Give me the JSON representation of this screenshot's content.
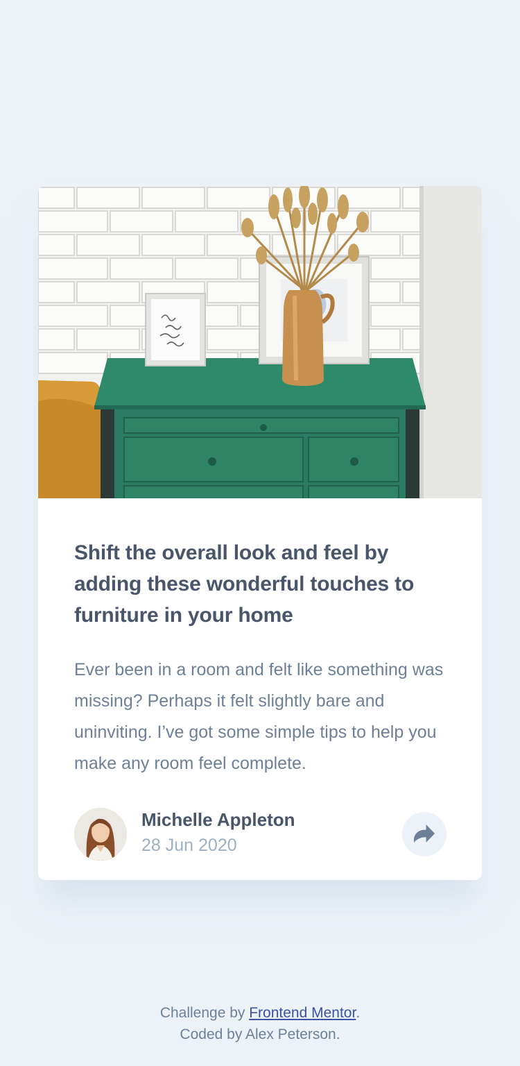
{
  "card": {
    "image_alt": "Green drawer with framed prints and vase of dried grass",
    "title": "Shift the overall look and feel by adding these wonderful touches to furniture in your home",
    "description": "Ever been in a room and felt like something was missing? Perhaps it felt slightly bare and uninviting. I’ve got some simple tips to help you make any room feel complete.",
    "author": {
      "name": "Michelle Appleton",
      "date": "28 Jun 2020",
      "avatar_icon": "avatar-michelle"
    },
    "share_icon": "share-icon"
  },
  "attribution": {
    "prefix": "Challenge by ",
    "link_text": "Frontend Mentor",
    "suffix": ".",
    "line2": "Coded by Alex Peterson."
  },
  "colors": {
    "background": "#ecf2f8",
    "card": "#ffffff",
    "title": "#48556a",
    "body_text": "#6e8098",
    "date": "#9eafc2",
    "link": "#3e52a3",
    "drawer_green": "#2b7a62"
  }
}
